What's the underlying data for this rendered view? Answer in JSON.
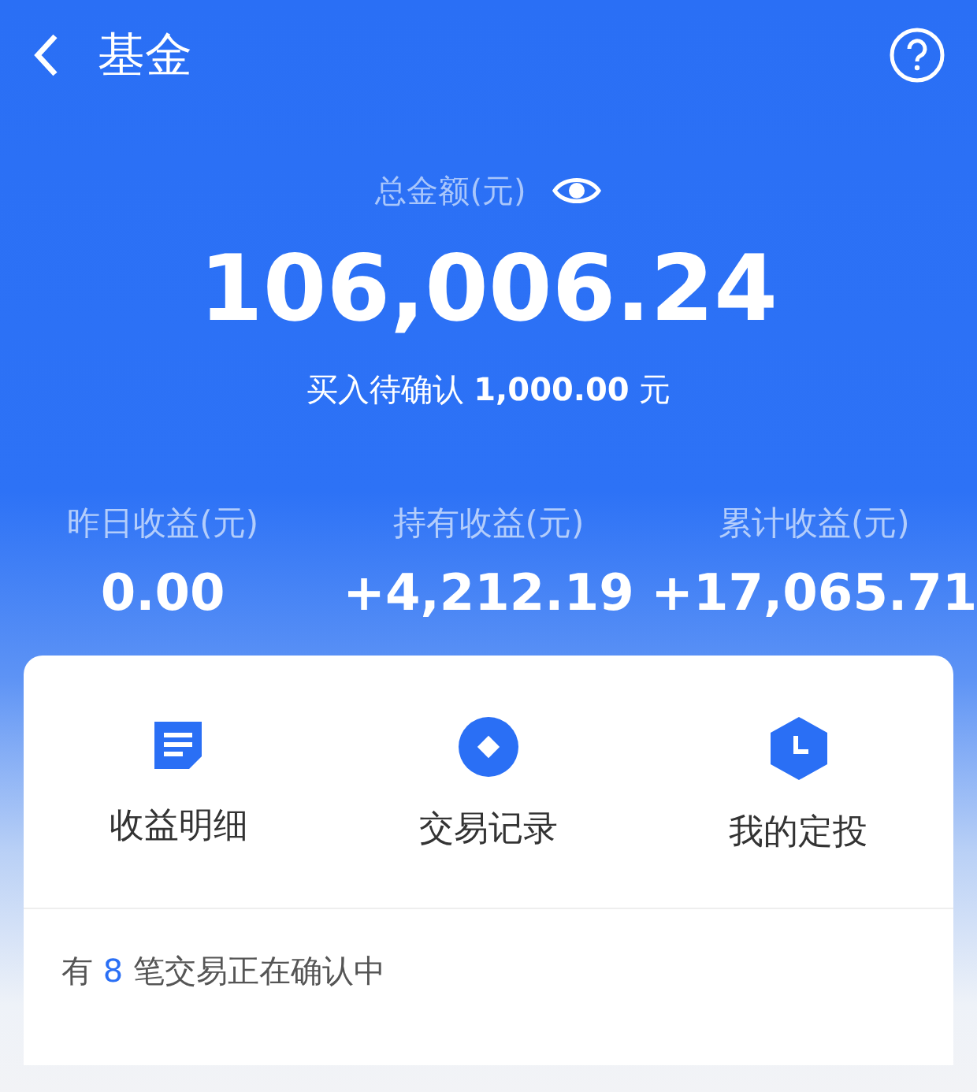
{
  "header": {
    "title": "基金"
  },
  "total": {
    "label": "总金额(元)",
    "amount": "106,006.24",
    "pending": "买入待确认 **1,000.00** 元"
  },
  "stats": [
    {
      "label": "昨日收益(元)",
      "value": "0.00"
    },
    {
      "label": "持有收益(元)",
      "value": "+4,212.19"
    },
    {
      "label": "累计收益(元)",
      "value": "+17,065.71"
    }
  ],
  "actions": [
    {
      "kind": "document",
      "label": "收益明细"
    },
    {
      "kind": "coin",
      "label": "交易记录"
    },
    {
      "kind": "clock",
      "label": "我的定投"
    }
  ],
  "notice": {
    "prefix": "有",
    "count": "8",
    "suffix": "笔交易正在确认中"
  }
}
